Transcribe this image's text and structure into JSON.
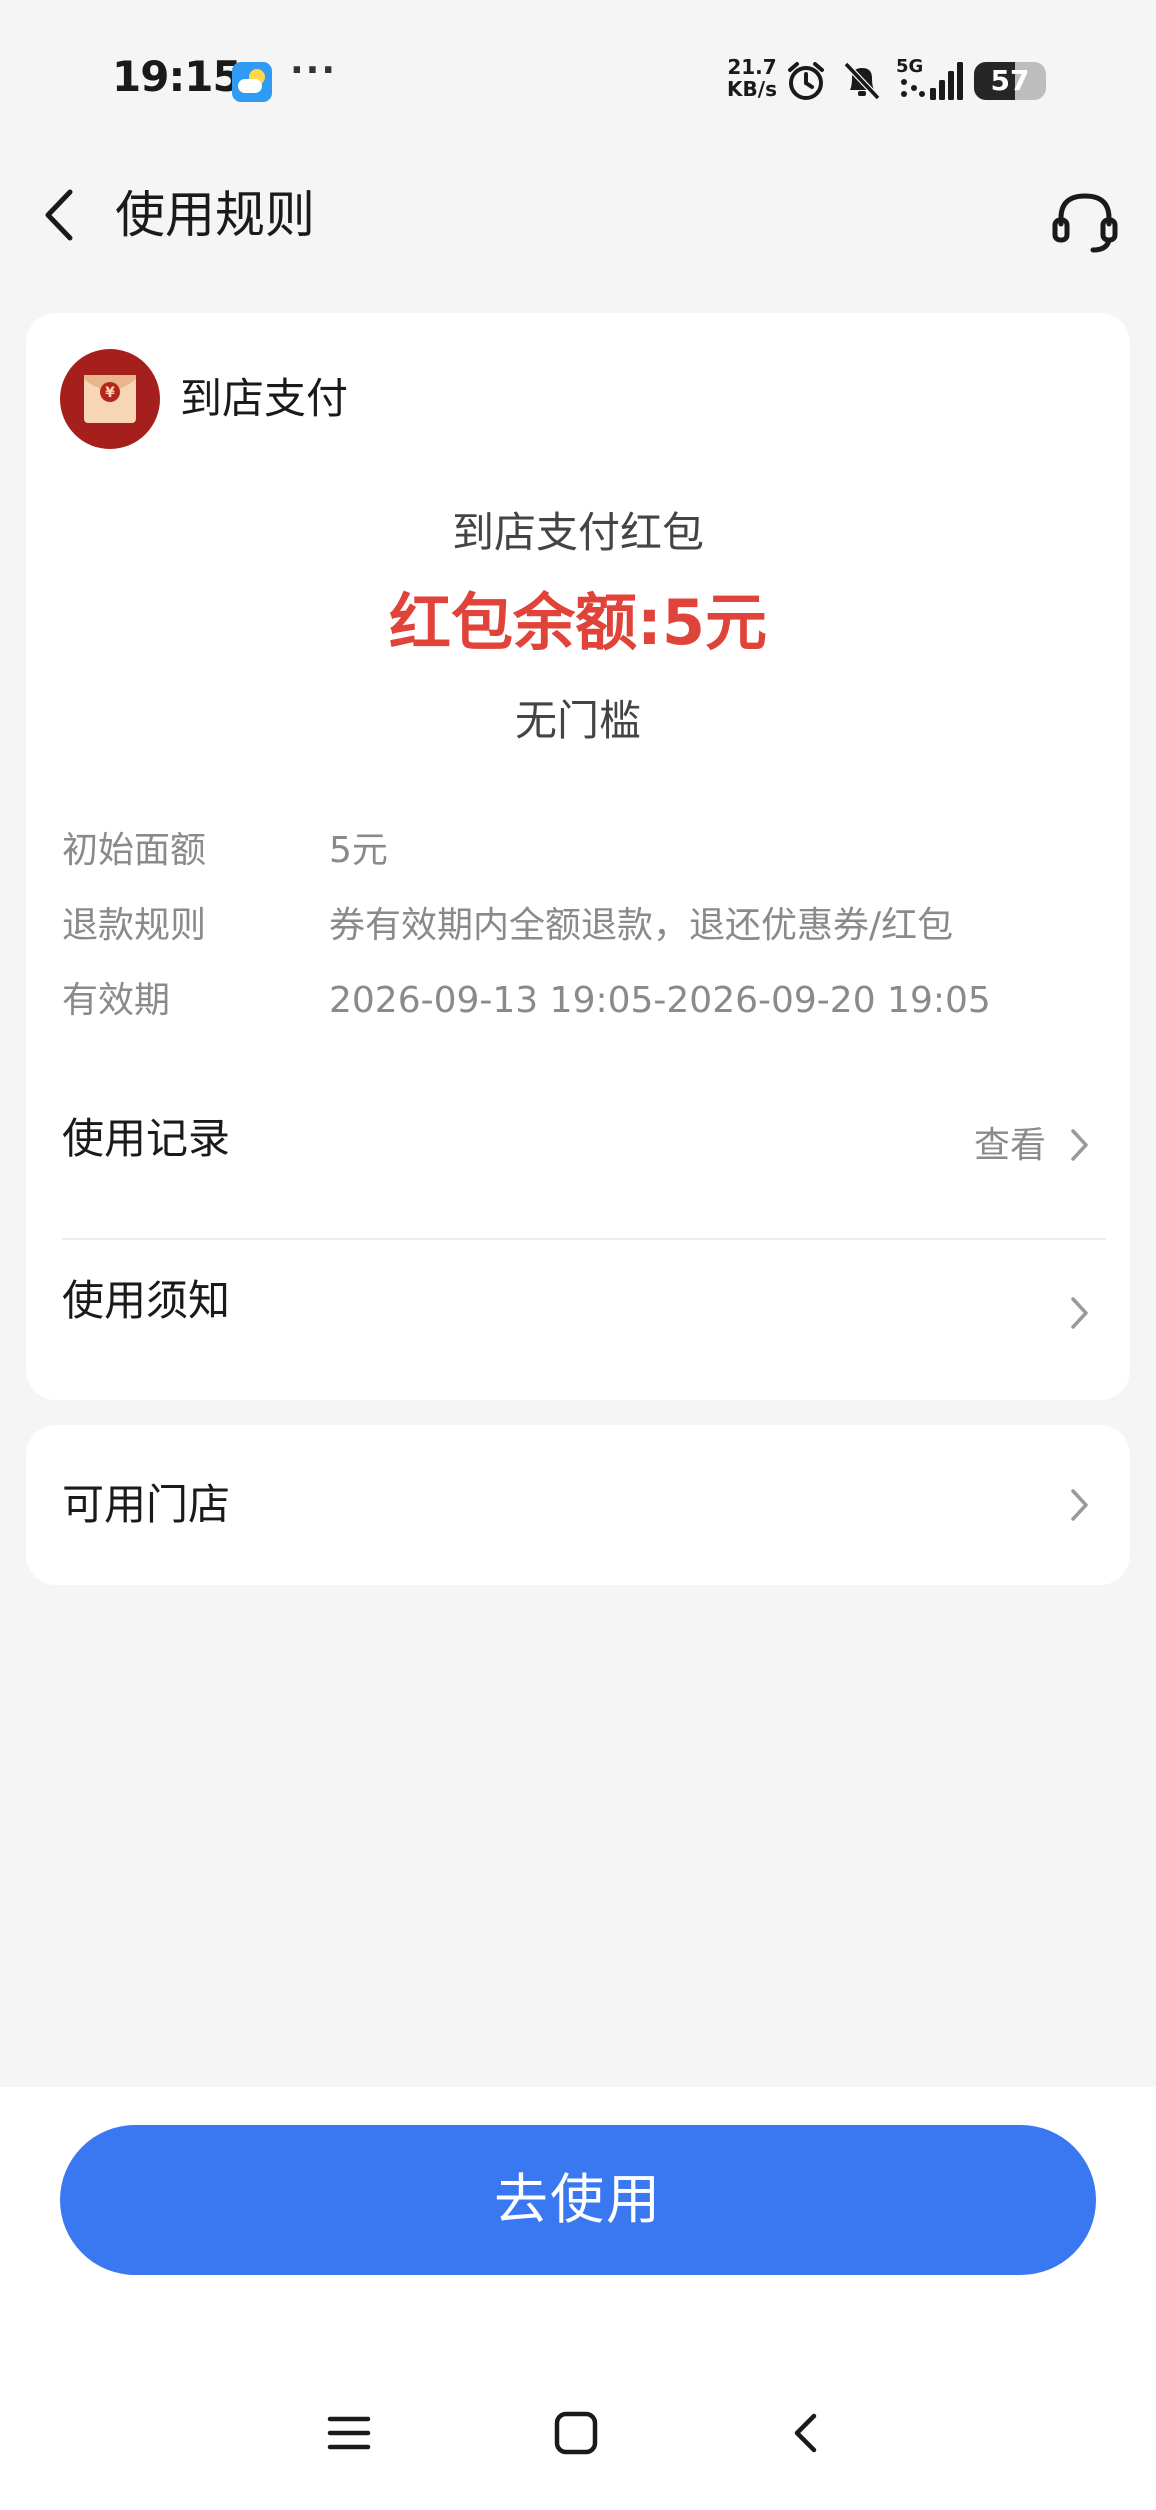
{
  "status_bar": {
    "time": "19:15",
    "network_speed_value": "21.7",
    "network_speed_unit": "KB/s",
    "network_type": "5G",
    "battery_percent": 57
  },
  "header": {
    "title": "使用规则"
  },
  "merchant": {
    "name": "到店支付",
    "logo_symbol": "¥"
  },
  "coupon": {
    "name": "到店支付红包",
    "balance": "红包余额:5元",
    "threshold": "无门槛"
  },
  "details": [
    {
      "label": "初始面额",
      "value": "5元"
    },
    {
      "label": "退款规则",
      "value": "券有效期内全额退款，退还优惠券/红包"
    },
    {
      "label": "有效期",
      "value": "2026-09-13 19:05-2026-09-20 19:05"
    }
  ],
  "rows": {
    "usage_record": {
      "title": "使用记录",
      "action": "查看"
    },
    "usage_notice": {
      "title": "使用须知"
    },
    "stores": {
      "title": "可用门店"
    }
  },
  "cta": {
    "label": "去使用"
  },
  "colors": {
    "accent_blue": "#3a78f2",
    "balance_red": "#e0433a",
    "logo_red": "#a51f1c",
    "page_bg": "#f5f5f5"
  },
  "icons": {
    "back": "chevron-left-icon",
    "support": "headset-icon",
    "row_arrow": "chevron-right-icon",
    "nav_menu": "menu-icon",
    "nav_home": "home-square-icon",
    "nav_back": "back-chevron-icon"
  }
}
